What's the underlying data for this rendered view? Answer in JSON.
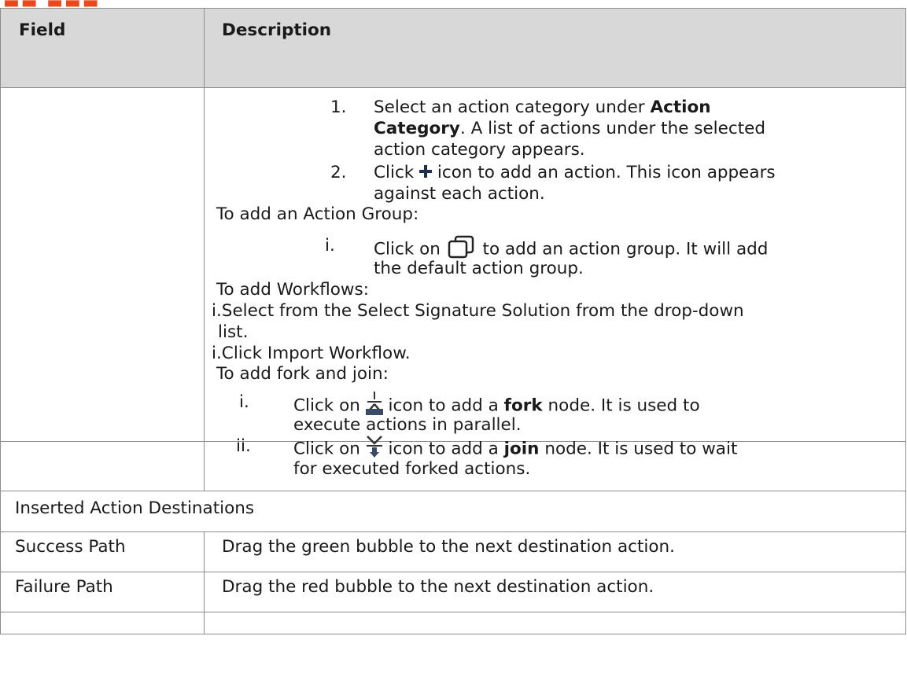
{
  "table": {
    "headers": {
      "field": "Field",
      "description": "Description"
    },
    "steps": {
      "step1_num": "1.",
      "step1_a": "Select an action category under ",
      "step1_bold1": "Action",
      "step1_bold2": "Category",
      "step1_b": ". A list of actions under the selected",
      "step1_c": "action category appears.",
      "step2_num": "2.",
      "step2_a": "Click ",
      "step2_b": " icon to add an action. This icon appears",
      "step2_c": "against each action."
    },
    "action_group": {
      "heading": "To add an Action Group:",
      "num": "i.",
      "a": "Click on ",
      "b": " to add an action group. It will add",
      "c": "the default action group."
    },
    "workflows": {
      "heading": "To add  Workflows:",
      "item1_a": "i.Select from the Select Signature Solution from the  drop-down",
      "item1_b": "list.",
      "item2": "i.Click Import Workflow."
    },
    "fork_join": {
      "heading": "To add fork and join:",
      "fork_num": "i.",
      "fork_a": "Click on ",
      "fork_b": " icon to add a ",
      "fork_bold": "fork",
      "fork_c": " node. It is used to",
      "fork_d": "execute actions in parallel.",
      "join_num": "ii.",
      "join_a": "Click on ",
      "join_b": " icon to add a ",
      "join_bold": "join",
      "join_c": " node. It is used to wait",
      "join_d": "for executed forked actions."
    },
    "section": "Inserted Action Destinations",
    "rows": [
      {
        "field": "Success Path",
        "description": "Drag the green bubble to the next destination action."
      },
      {
        "field": "Failure Path",
        "description": "Drag the red bubble to the next destination action."
      }
    ]
  },
  "icons": {
    "add": "plus-icon",
    "action_group": "action-group-icon",
    "fork": "fork-icon",
    "join": "join-icon"
  },
  "colors": {
    "header_bg": "#d8d8d8",
    "border": "#8c8c8c",
    "heading_accent": "#e8491d"
  }
}
